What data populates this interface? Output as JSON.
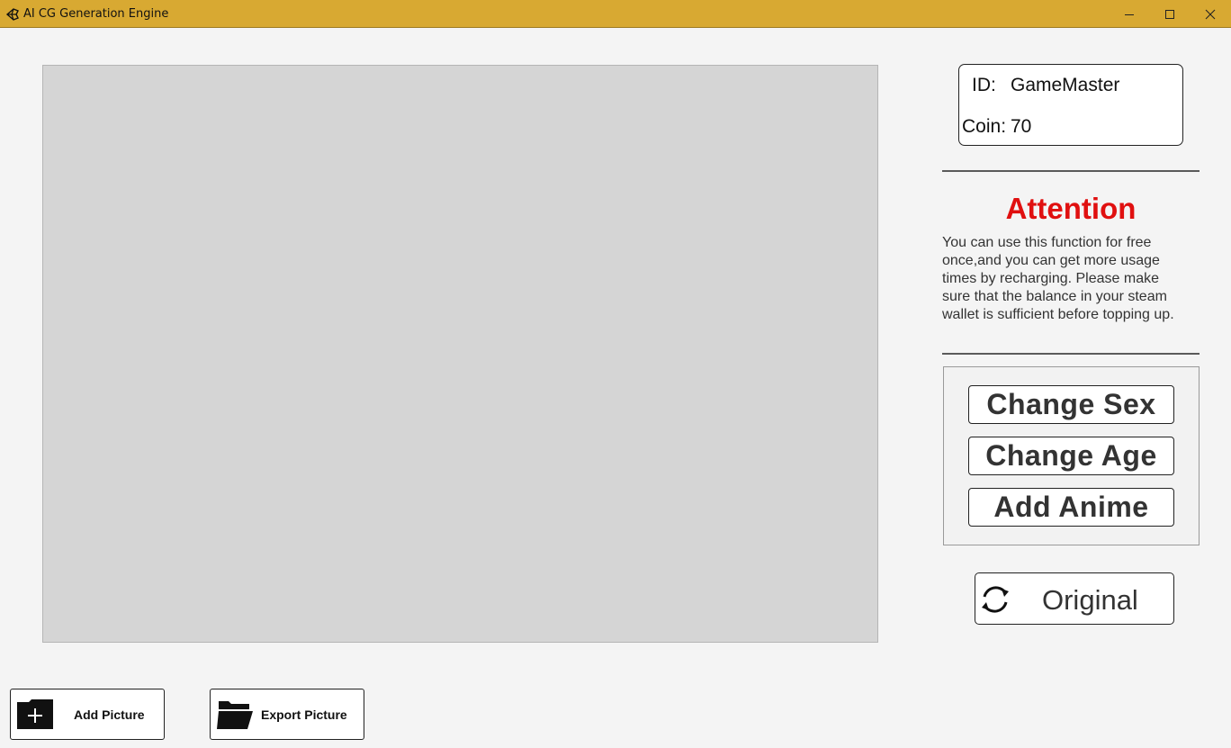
{
  "window": {
    "title": "AI CG Generation Engine",
    "titlebar_color": "#d8a932"
  },
  "user": {
    "id_label": "ID:",
    "id_value": "GameMaster",
    "coin_label": "Coin:",
    "coin_value": "70"
  },
  "attention": {
    "title": "Attention",
    "title_color": "#e01010",
    "lines": [
      "You can use this function for free",
      "once,and you can get more usage",
      "times by recharging. Please make",
      "sure that the balance in your steam",
      "wallet is sufficient before topping up."
    ]
  },
  "functions": {
    "change_sex": "Change Sex",
    "change_age": "Change Age",
    "add_anime": "Add Anime"
  },
  "original": {
    "label": "Original",
    "icon": "refresh-icon"
  },
  "bottom": {
    "add_picture": "Add Picture",
    "add_picture_icon": "folder-plus-icon",
    "export_picture": "Export Picture",
    "export_picture_icon": "folder-open-icon"
  }
}
